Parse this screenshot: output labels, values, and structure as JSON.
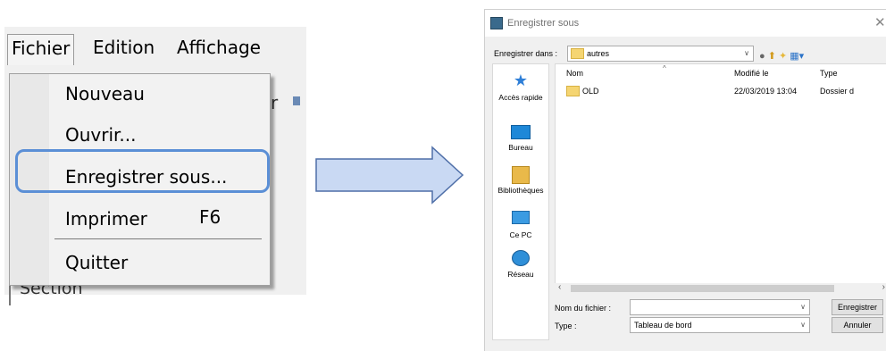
{
  "left_menu": {
    "menubar": [
      "Fichier",
      "Edition",
      "Affichage"
    ],
    "items": [
      {
        "label": "Nouveau"
      },
      {
        "label": "Ouvrir..."
      },
      {
        "label": "Enregistrer sous..."
      },
      {
        "label": "Imprimer",
        "shortcut": "F6"
      },
      {
        "label": "Quitter"
      }
    ],
    "highlighted_item": "Enregistrer sous...",
    "background_text": {
      "partial_1": "r",
      "section": "Section"
    },
    "highlight_color": "#5b8fd6"
  },
  "arrow_color": "#c9d9f3",
  "dialog": {
    "title": "Enregistrer sous",
    "save_in_label": "Enregistrer dans :",
    "save_in_value": "autres",
    "places": [
      "Accès rapide",
      "Bureau",
      "Bibliothèques",
      "Ce PC",
      "Réseau"
    ],
    "columns": [
      "Nom",
      "Modifié le",
      "Type"
    ],
    "files": [
      {
        "name": "OLD",
        "modified": "22/03/2019 13:04",
        "type": "Dossier d"
      }
    ],
    "filename_label": "Nom du fichier :",
    "filename_value": "",
    "type_label": "Type :",
    "type_value": "Tableau de bord",
    "save_button": "Enregistrer",
    "cancel_button": "Annuler"
  }
}
